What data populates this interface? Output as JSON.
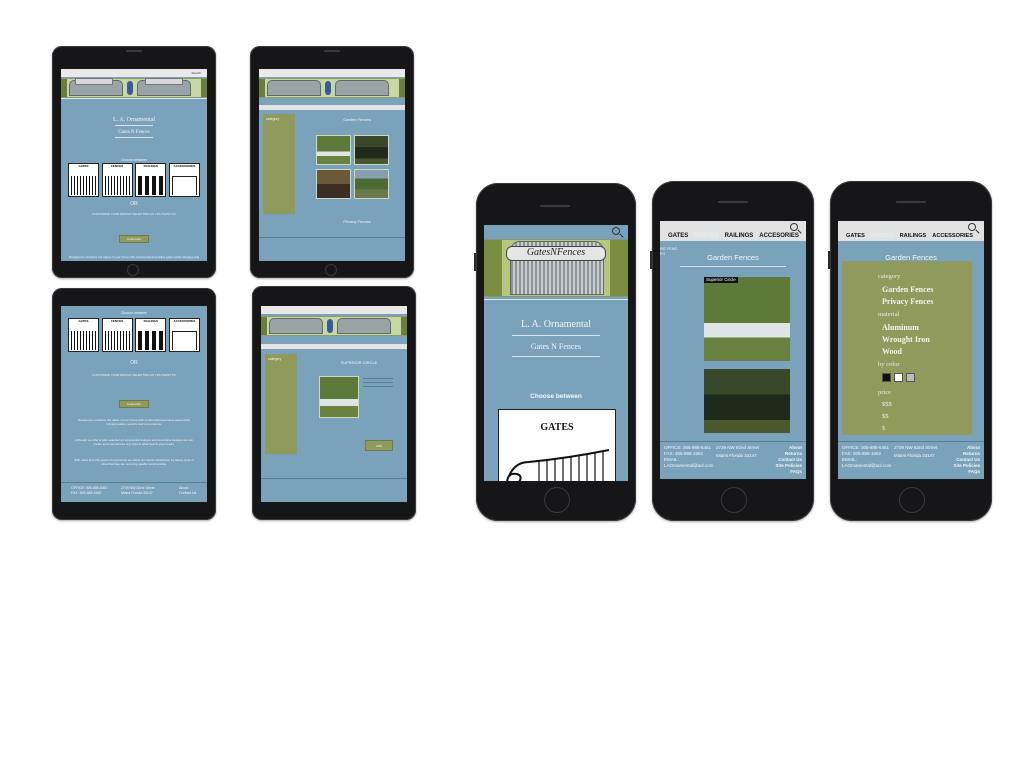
{
  "brand": {
    "company": "L. A. Ornamental",
    "tagline": "Gates N Fences",
    "logo_sign": "GatesNFences",
    "logo_sign_spaced": "Gates N Fences"
  },
  "tablets": {
    "home": {
      "choose": "Choose between",
      "categories": [
        "GATES",
        "FENCES",
        "RAILINGS",
        "ACCESSORIES"
      ],
      "or": "OR",
      "custom": "CUSTOMIZE YOUR DESIGN SELECTING AS YOU WANT TO",
      "customize_button": "Customize",
      "intro_1": "Designed to enhance the value of your home with ornamental decorative gates while bringing safety, security and convenience.",
      "intro_2": "Although we offer a wide selection of ornamental designs and decorative designs we can create and manufacture any style to what best fit your needs.",
      "intro_3": "With more than fifty years of experience we stand out clients satisfaction by taking pride of what that they are receiving quality workmanship.",
      "footer_left": [
        "OFFICE: 305-888-6461",
        "FAX: 305-888-1662",
        "EMAIL: LAOrnamental@aol.com"
      ],
      "footer_mid": [
        "2739 NW 82nd Street",
        "Miami Florida 33147"
      ],
      "footer_right": [
        "About",
        "Contact Us",
        "Site Policies",
        "FAQs"
      ]
    },
    "fences": {
      "title": "Garden Fences",
      "title2": "Privacy Fences",
      "sidebar_heading": "category"
    },
    "detail": {
      "title": "SUPERIOR CIRCLE",
      "sidebar_heading": "category",
      "add_button": "ADD"
    }
  },
  "phones": {
    "home": {
      "company": "L. A. Ornamental",
      "tagline": "Gates N Fences",
      "choose": "Choose between",
      "first_choice": "GATES"
    },
    "fences": {
      "nav": [
        "GATES",
        "FENCES",
        "RAILINGS",
        "ACCESORIES"
      ],
      "active": "FENCES",
      "breadcrumb": [
        "RS FENC",
        "RY"
      ],
      "title": "Garden Fences",
      "photo_label": "Superior Circle",
      "footer_left": [
        "OFFICE: 305-888-6461",
        "FAX: 305-888-1662",
        "EMAIL:",
        "LAOrnamental@aol.com"
      ],
      "footer_mid": [
        "2739 NW 82nd Street",
        "Miami Florida 33147"
      ],
      "footer_right": [
        "About",
        "Returns",
        "Contact Us",
        "Site Policies",
        "FAQs"
      ]
    },
    "filter": {
      "nav": [
        "GATES",
        "FENCES",
        "RAILINGS",
        "ACCESSORIES"
      ],
      "active": "FENCES",
      "title": "Garden Fences",
      "category_label": "category",
      "categories": [
        "Garden Fences",
        "Privacy Fences"
      ],
      "material_label": "material",
      "materials": [
        "Aluminum",
        "Wrought Iron",
        "Wood"
      ],
      "color_label": "by color",
      "colors": [
        "#111111",
        "#ffffff",
        "#bbbbbb"
      ],
      "price_label": "price",
      "prices": [
        "$$$",
        "$$",
        "$"
      ],
      "footer_left": [
        "OFFICE: 305-888-6461",
        "FAX: 305-888-1662",
        "EMAIL:",
        "LAOrnamental@aol.com"
      ],
      "footer_mid": [
        "2739 NW 82nd Street",
        "Miami Florida 33147"
      ],
      "footer_right": [
        "About",
        "Returns",
        "Contact Us",
        "Site Policies",
        "FAQs"
      ]
    }
  },
  "colors": {
    "screen_blue": "#7aa3bb",
    "olive": "#8f9a5c",
    "device": "#161618"
  }
}
